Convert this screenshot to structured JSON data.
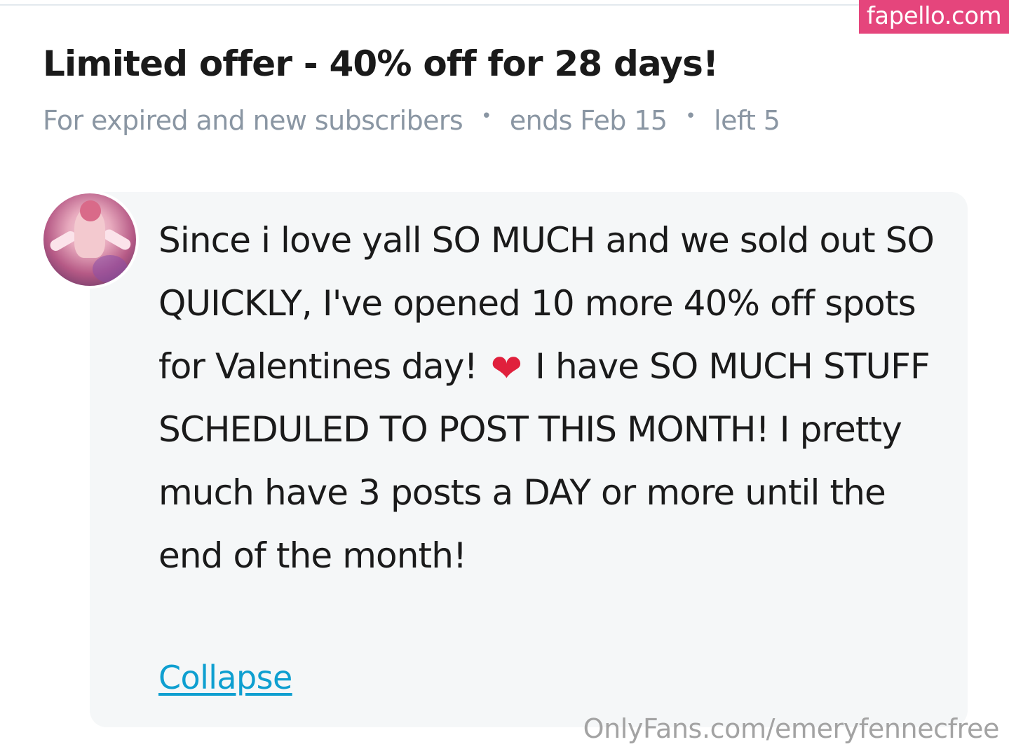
{
  "watermark": {
    "badge_text": "fapello.com",
    "url_text": "OnlyFans.com/emeryfennecfree"
  },
  "offer": {
    "title": "Limited offer - 40% off for 28 days!",
    "audience": "For expired and new subscribers",
    "separator": "•",
    "ends": "ends Feb 15",
    "left": "left 5"
  },
  "message": {
    "text_before_emoji": "Since i love yall SO MUCH and we sold out SO QUICKLY, I've opened 10 more 40% off spots for Valentines day!",
    "emoji": "❤",
    "text_after_emoji": "I have SO MUCH STUFF SCHEDULED TO POST THIS MONTH! I pretty much have 3 posts a DAY or more until the end of the month!",
    "collapse_label": "Collapse"
  },
  "colors": {
    "badge_bg": "#e5457c",
    "meta_text": "#8a96a3",
    "card_bg": "#f5f7f8",
    "link": "#0e9fd0"
  },
  "icons": {
    "emoji": "heart-emoji-icon"
  }
}
